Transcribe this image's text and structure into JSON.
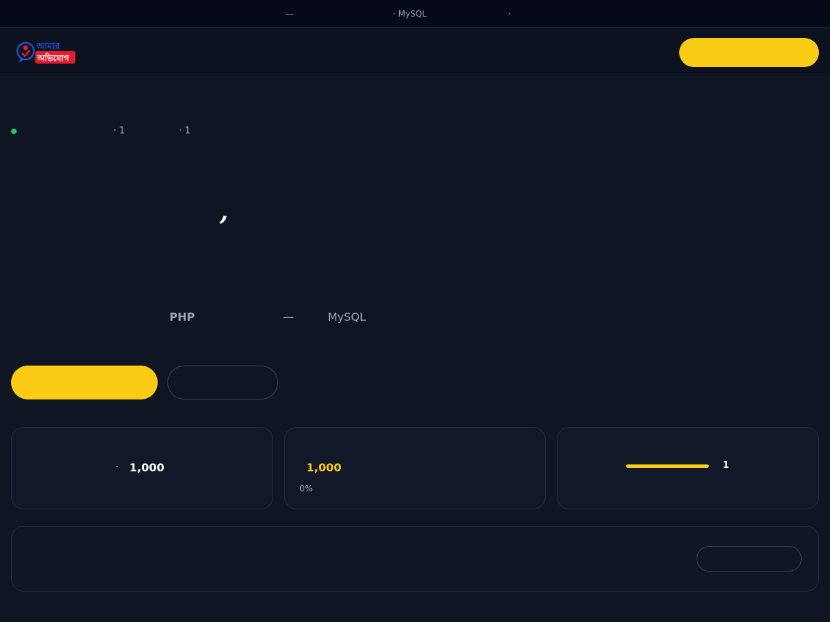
{
  "topbar": {
    "dash": "—",
    "mysql": "· MySQL",
    "dot": "·"
  },
  "header": {
    "logo_text_top": "আমার",
    "logo_text_bottom": "অভিযোগ",
    "cta_label": ""
  },
  "hero": {
    "meta_1": "· 1",
    "meta_2": "· 1",
    "apostrophe": "’",
    "tech_php": "PHP",
    "tech_dash": "—",
    "tech_mysql": "MySQL",
    "primary_label": "",
    "secondary_label": ""
  },
  "stats": {
    "card1": {
      "dot": "·",
      "value": "1,000"
    },
    "card2": {
      "value": "1,000",
      "percent": "0%"
    },
    "card3": {
      "value": "1",
      "progress": 1.0
    }
  },
  "panel": {
    "button_label": ""
  },
  "colors": {
    "accent": "#facc15",
    "status": "#22c55e",
    "logo_red": "#e11d2e",
    "logo_blue": "#1d4ed8"
  }
}
